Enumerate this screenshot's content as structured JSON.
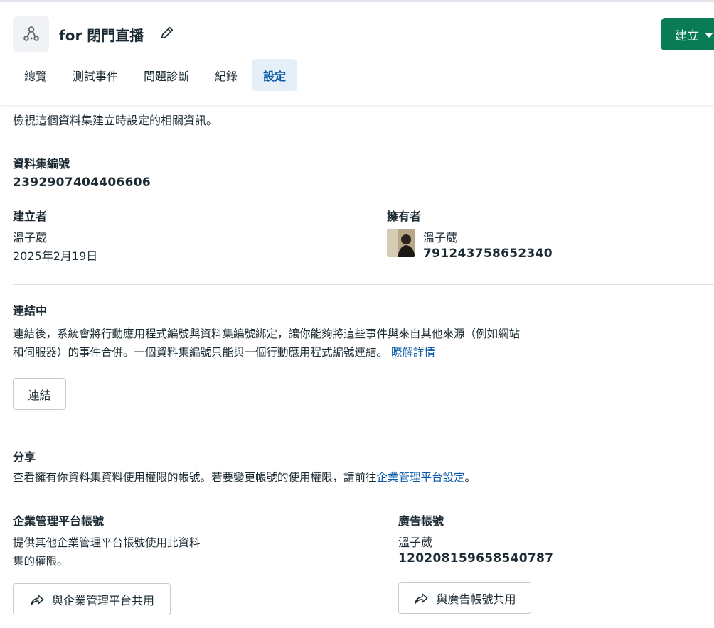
{
  "header": {
    "title": "for 閉門直播",
    "create_label": "建立",
    "tabs": [
      {
        "label": "總覽",
        "active": false
      },
      {
        "label": "測試事件",
        "active": false
      },
      {
        "label": "問題診斷",
        "active": false
      },
      {
        "label": "紀錄",
        "active": false
      },
      {
        "label": "設定",
        "active": true
      }
    ]
  },
  "settings": {
    "intro": "檢視這個資料集建立時設定的相關資訊。",
    "dataset_id": {
      "label": "資料集編號",
      "value": "2392907404406606"
    },
    "creator": {
      "label": "建立者",
      "name": "溫子葳",
      "date": "2025年2月19日"
    },
    "owner": {
      "label": "擁有者",
      "name": "溫子葳",
      "id": "791243758652340"
    },
    "connect": {
      "title": "連結中",
      "desc_line1": "連結後，系統會將行動應用程式編號與資料集編號綁定，讓你能夠將這些事件與來自其他來源（例如網站",
      "desc_line2": "和伺服器）的事件合併。一個資料集編號只能與一個行動應用程式編號連結。",
      "learn_more": "瞭解詳情",
      "button": "連結"
    },
    "share": {
      "title": "分享",
      "desc_prefix": "查看擁有你資料集資料使用權限的帳號。若要變更帳號的使用權限，請前往",
      "desc_link": "企業管理平台設定",
      "desc_suffix": "。",
      "business": {
        "label": "企業管理平台帳號",
        "desc_line1": "提供其他企業管理平台帳號使用此資料",
        "desc_line2": "集的權限。",
        "button": "與企業管理平台共用"
      },
      "ad_account": {
        "label": "廣告帳號",
        "name": "溫子葳",
        "id": "120208159658540787",
        "button": "與廣告帳號共用"
      }
    }
  },
  "colors": {
    "accent": "#0a7c55",
    "link": "#0a5aa8",
    "active_tab_bg": "#e4eff8"
  }
}
